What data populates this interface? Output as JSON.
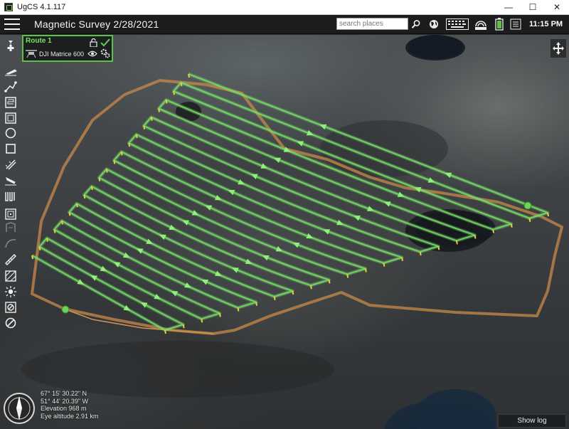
{
  "window": {
    "title": "UgCS 4.1.117",
    "minimize": "—",
    "maximize": "☐",
    "close": "✕"
  },
  "toolbar": {
    "menu_icon": "hamburger-menu-icon",
    "mission_title": "Magnetic Survey 2/28/2021",
    "search_placeholder": "search places",
    "time": "11:15 PM",
    "icons": [
      "search-icon",
      "globe-icon",
      "keyboard-icon",
      "telemetry-icon",
      "battery-icon",
      "fullscreen-icon"
    ]
  },
  "route_panel": {
    "name": "Route 1",
    "vehicle": "DJI Matrice 600",
    "icons": [
      "lock-icon",
      "check-icon",
      "eye-icon",
      "settings-icon",
      "drone-icon"
    ],
    "accent": "#5ec24a"
  },
  "left_tools": [
    "takeoff-icon",
    "waypoint-path-icon",
    "area-scan-icon",
    "photogrammetry-icon",
    "circle-icon",
    "perimeter-icon",
    "corridor-icon",
    "landing-icon",
    "magnetic-survey-icon",
    "spiral-icon",
    "import-icon",
    "curve-icon",
    "ruler-icon",
    "no-fly-zone-icon",
    "sun-icon",
    "cancel-icon",
    "forbidden-icon"
  ],
  "right_tool": "move-icon",
  "map": {
    "lat": "67° 15' 30.22\" N",
    "lon": "51° 44' 20.39\" W",
    "elevation": "Elevation 968 m",
    "eye_altitude": "Eye altitude 2.91 km",
    "route_color": "#79e06a",
    "boundary_color": "#c88a4a"
  },
  "show_log_label": "Show log"
}
